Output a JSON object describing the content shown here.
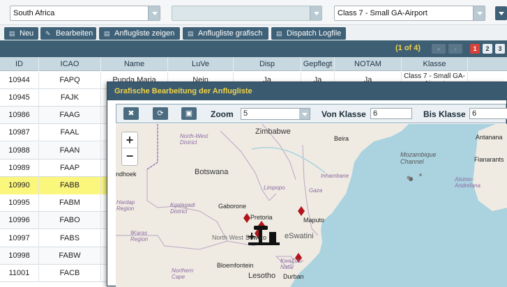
{
  "filters": {
    "country": "South Africa",
    "middle": "",
    "klasse": "Class 7 - Small GA-Airport"
  },
  "toolbar": {
    "neu": "Neu",
    "bearbeiten": "Bearbeiten",
    "zeigen": "Anflugliste zeigen",
    "grafisch": "Anflugliste grafisch",
    "dispatch": "Dispatch Logfile"
  },
  "pager": {
    "count": "(1 of 4)",
    "pages": [
      "1",
      "2",
      "3"
    ],
    "active": "1"
  },
  "grid": {
    "columns": [
      "ID",
      "ICAO",
      "Name",
      "LuVe",
      "Disp",
      "Gepflegt",
      "NOTAM",
      "Klasse"
    ],
    "first_row": {
      "id": "10944",
      "icao": "FAPQ",
      "name": "Punda Maria",
      "luve": "Nein",
      "disp": "Ja",
      "gepflegt": "Ja",
      "notam": "Ja",
      "klasse": "Class 7 - Small GA-Airport"
    },
    "rows": [
      {
        "id": "10945",
        "icao": "FAJK"
      },
      {
        "id": "10986",
        "icao": "FAAG"
      },
      {
        "id": "10987",
        "icao": "FAAL"
      },
      {
        "id": "10988",
        "icao": "FAAN"
      },
      {
        "id": "10989",
        "icao": "FAAP"
      },
      {
        "id": "10990",
        "icao": "FABB",
        "selected": true
      },
      {
        "id": "10995",
        "icao": "FABM"
      },
      {
        "id": "10996",
        "icao": "FABO"
      },
      {
        "id": "10997",
        "icao": "FABS"
      },
      {
        "id": "10998",
        "icao": "FABW"
      },
      {
        "id": "11001",
        "icao": "FACB"
      }
    ]
  },
  "dialog": {
    "title": "Grafische Bearbeitung der Anflugliste",
    "zoom_label": "Zoom",
    "zoom_value": "5",
    "von_label": "Von Klasse",
    "von_value": "6",
    "bis_label": "Bis Klasse",
    "bis_value": "6",
    "icons": {
      "close": "close-icon",
      "refresh": "refresh-icon",
      "save": "save-icon"
    }
  },
  "map": {
    "zoom_in": "+",
    "zoom_out": "−",
    "labels": {
      "zimbabwe": "Zimbabwe",
      "north_west_district": "North-West\nDistrict",
      "botswana": "Botswana",
      "windhoek": "ndhoek",
      "hardap": "Hardap\nRegion",
      "kgalagadi": "Kgalagadi\nDistrict",
      "limpopo": "Limpopo",
      "gaza": "Gaza",
      "inhambane": "Inhambane",
      "gaborone": "Gaborone",
      "pretoria": "Pretoria",
      "maputo": "Maputo",
      "karas": "ǁKaras\nRegion",
      "north_west": "North West",
      "soweto": "Soweto",
      "eswatini": "eSwatini",
      "bloemfontein": "Bloemfontein",
      "northern_cape": "Northern\nCape",
      "lesotho": "Lesotho",
      "kwazulu": "KwaZulu-\nNatal",
      "durban": "Durban",
      "beira": "Beira",
      "mozambique_channel": "Mozambique\nChannel",
      "antananarivo": "Antanana",
      "fianarantsoa": "Fianarants",
      "atsimo": "Atsimo-\nAndrefana"
    },
    "colors": {
      "marker": "#b1151c",
      "water": "#aad3df",
      "land": "#efebe3"
    }
  }
}
